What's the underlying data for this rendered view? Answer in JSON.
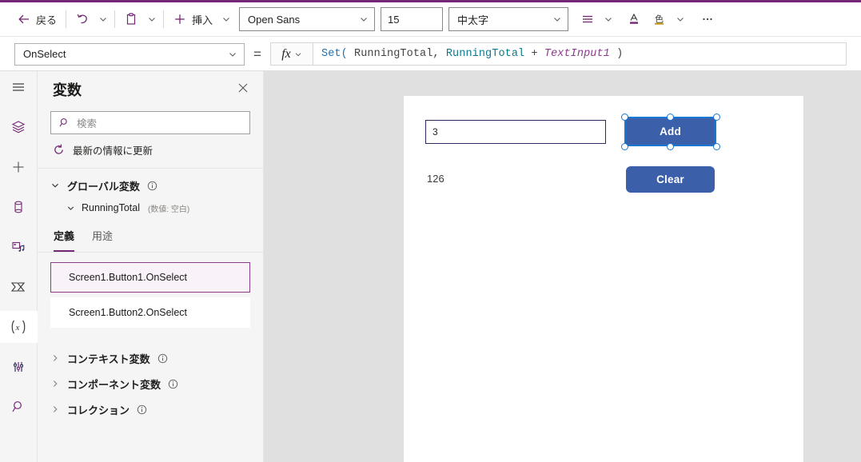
{
  "theme": {
    "accent_purple": "#742774",
    "selection_blue": "#1878d4",
    "control_blue": "#3b5fa8",
    "workspace_gray": "#e0e0e0"
  },
  "toolbar": {
    "back_label": "戻る",
    "back_icon": "arrow-left-icon",
    "undo_icon": "undo-icon",
    "undo_chevron_icon": "chevron-down-icon",
    "paste_icon": "clipboard-icon",
    "paste_chevron_icon": "chevron-down-icon",
    "insert_icon": "plus-icon",
    "insert_label": "挿入",
    "insert_chevron_icon": "chevron-down-icon",
    "font_family_value": "Open Sans",
    "font_family_chevron_icon": "chevron-down-icon",
    "font_size_value": "15",
    "font_weight_value": "中太字",
    "font_weight_chevron_icon": "chevron-down-icon",
    "align_icon": "align-lines-icon",
    "align_chevron_icon": "chevron-down-icon",
    "font_color_icon": "font-color-a-icon",
    "fill_color_label": "色",
    "fill_color_icon": "fill-color-icon",
    "fill_color_chevron_icon": "chevron-down-icon",
    "overflow_label": "…",
    "overflow_icon": "ellipsis-icon"
  },
  "formula_bar": {
    "property_value": "OnSelect",
    "property_chevron_icon": "chevron-down-icon",
    "equals": "=",
    "fx_label": "fx",
    "fx_chevron_icon": "chevron-down-icon",
    "formula_tokens": [
      {
        "text": "Set(",
        "kind": "fn"
      },
      {
        "text": " RunningTotal, ",
        "kind": "txt"
      },
      {
        "text": "RunningTotal",
        "kind": "var"
      },
      {
        "text": " + ",
        "kind": "txt"
      },
      {
        "text": "TextInput1",
        "kind": "ctl"
      },
      {
        "text": " )",
        "kind": "txt"
      }
    ],
    "formula_plain": "Set( RunningTotal, RunningTotal + TextInput1 )"
  },
  "rail": {
    "items": [
      {
        "icon": "hamburger-menu-icon",
        "selected": false
      },
      {
        "icon": "tree-view-layers-icon",
        "selected": false
      },
      {
        "icon": "insert-plus-icon",
        "selected": false
      },
      {
        "icon": "data-cylinder-icon",
        "selected": false
      },
      {
        "icon": "media-icon",
        "selected": false
      },
      {
        "icon": "power-automate-flow-icon",
        "selected": false
      },
      {
        "icon": "variables-x-icon",
        "selected": true
      },
      {
        "icon": "advanced-tools-icon",
        "selected": false
      },
      {
        "icon": "search-icon",
        "selected": false
      }
    ]
  },
  "panel": {
    "title": "変数",
    "close_icon": "close-icon",
    "search_icon": "search-icon",
    "search_placeholder": "検索",
    "search_value": "",
    "refresh_icon": "refresh-icon",
    "refresh_label": "最新の情報に更新",
    "global_group": {
      "chevron_icon": "chevron-down-icon",
      "label": "グローバル変数",
      "info_icon": "info-icon",
      "variables": [
        {
          "chevron_icon": "chevron-down-icon",
          "name": "RunningTotal",
          "type_note": "(数値: 空白)"
        }
      ]
    },
    "tabs": [
      {
        "label": "定義",
        "active": true
      },
      {
        "label": "用途",
        "active": false
      }
    ],
    "definitions": [
      {
        "label": "Screen1.Button1.OnSelect",
        "selected": true
      },
      {
        "label": "Screen1.Button2.OnSelect",
        "selected": false
      }
    ],
    "other_groups": [
      {
        "chevron_icon": "chevron-right-icon",
        "label": "コンテキスト変数",
        "info_icon": "info-icon"
      },
      {
        "chevron_icon": "chevron-right-icon",
        "label": "コンポーネント変数",
        "info_icon": "info-icon"
      },
      {
        "chevron_icon": "chevron-right-icon",
        "label": "コレクション",
        "info_icon": "info-icon"
      }
    ]
  },
  "canvas": {
    "text_input_value": "3",
    "result_label": "126",
    "add_button_label": "Add",
    "clear_button_label": "Clear",
    "selected_control": "Add"
  }
}
